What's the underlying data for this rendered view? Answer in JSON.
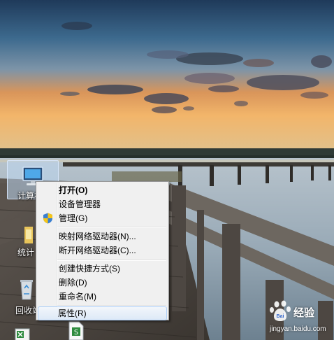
{
  "desktop": {
    "icons": [
      {
        "label": "计算机",
        "icon": "computer-icon"
      },
      {
        "label": "统计"
      },
      {
        "label": "回收站",
        "icon": "recycle-bin-icon"
      },
      {
        "label": "",
        "icon": "spreadsheet-icon"
      },
      {
        "label": "",
        "icon": "document-icon"
      }
    ]
  },
  "context_menu": {
    "items": [
      {
        "label": "打开(O)"
      },
      {
        "label": "设备管理器"
      },
      {
        "label": "管理(G)",
        "icon": "uac-shield-icon"
      },
      {
        "label": "映射网络驱动器(N)..."
      },
      {
        "label": "断开网络驱动器(C)..."
      },
      {
        "label": "创建快捷方式(S)"
      },
      {
        "label": "删除(D)"
      },
      {
        "label": "重命名(M)"
      },
      {
        "label": "属性(R)"
      }
    ]
  },
  "watermark": {
    "brand": "经验",
    "logo_text": "Bai",
    "url": "jingyan.baidu.com"
  }
}
